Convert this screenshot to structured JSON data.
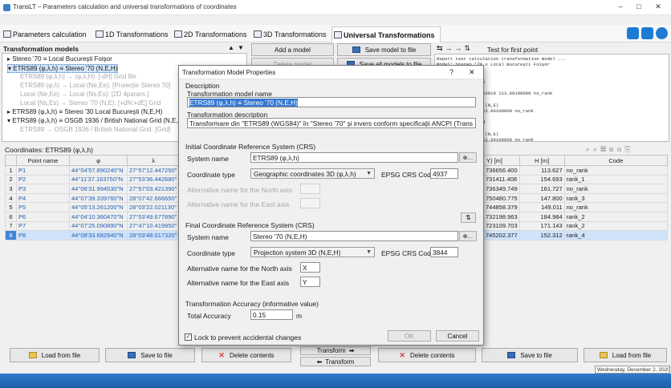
{
  "window": {
    "title": "TransLT – Parameters calculation and universal transformations of coordinates",
    "minimize": "–",
    "maximize": "□",
    "close": "✕"
  },
  "ribbon": {
    "tabs": [
      {
        "label": "Parameters calculation",
        "icon": "calc-icon"
      },
      {
        "label": "1D Transformations",
        "icon": "ruler-icon"
      },
      {
        "label": "2D Transformations",
        "icon": "grid-icon"
      },
      {
        "label": "3D Transformations",
        "icon": "cube-icon"
      },
      {
        "label": "Universal Transformations",
        "icon": "globe-icon",
        "active": true
      }
    ],
    "right_icons": [
      "gear-icon",
      "help-icon"
    ]
  },
  "models_panel": {
    "header": "Transformation models",
    "tree": [
      {
        "text": "Stereo '70 ≡ Local București Foișor",
        "state": "normal"
      },
      {
        "text": "ETRS89 (φ,λ,h) ≡ Stereo '70 (N,E,H)",
        "state": "selected"
      },
      {
        "text": "ETRS89 (φ,λ,h) → (φ,λ,H): [-dH] Grid file",
        "state": "dim"
      },
      {
        "text": "ETRS89 (φ,λ) → Local (Ne,Ee): [Proiecție Stereo 70]",
        "state": "dim"
      },
      {
        "text": "Local (Ne,Ee) → Local (Ns,Es): [2D 4param.]",
        "state": "dim"
      },
      {
        "text": "Local (Ns,Es) → Stereo '70 (N,E): [+dN;+dE] Grid",
        "state": "dim"
      },
      {
        "text": "ETRS89 (φ,λ,h) ≡ Stereo '30 Local București (N,E,H)",
        "state": "normal"
      },
      {
        "text": "ETRS89 (φ,λ,h) ≡ OSGB 1936 / British National Grid (N,E,H)",
        "state": "normal"
      },
      {
        "text": "ETRS89 → OSGB 1936 / British National Grid: [Grid]",
        "state": "dim"
      }
    ]
  },
  "actions": {
    "add_model": "Add a model",
    "delete_model": "Delete model",
    "save_model": "Save model to file",
    "save_all": "Save all models to file",
    "test_first_point": "Test for first point"
  },
  "report": {
    "lines": [
      "Report test calculation transformation model ...",
      "Model: Stereo '70 ≡ Local București Foișor",
      "",
      "",
      "Direction: Reverse",
      "",
      "291315.301665 92953019 113.89100000 no_rank",
      "",
      "→ Local București (N,E)",
      "291310.67701068 113.89100000 no_rank",
      "",
      "Direction: Forward",
      "",
      "→ Local București (N,E)",
      "291310.67701068 113.89100000 no_rank"
    ]
  },
  "coordinates": {
    "header": "Coordinates: ETRS89 (φ,λ,h)",
    "columns": [
      "Point name",
      "φ",
      "λ"
    ],
    "rows": [
      {
        "n": "1",
        "name": "P1",
        "phi": "44°04'57.890240\"N",
        "lam": "27°57'12.447250\""
      },
      {
        "n": "2",
        "name": "P2",
        "phi": "44°11'37.163750\"N",
        "lam": "27°53'36.442680\""
      },
      {
        "n": "3",
        "name": "P3",
        "phi": "44°06'31.994530\"N",
        "lam": "27°57'03.421390\""
      },
      {
        "n": "4",
        "name": "P4",
        "phi": "44°07'39.339760\"N",
        "lam": "28°07'42.666650\""
      },
      {
        "n": "5",
        "name": "P5",
        "phi": "44°05'13.261200\"N",
        "lam": "28°03'22.021130\""
      },
      {
        "n": "6",
        "name": "P6",
        "phi": "44°04'10.360470\"N",
        "lam": "27°53'49.677890\""
      },
      {
        "n": "7",
        "name": "P7",
        "phi": "44°07'25.090890\"N",
        "lam": "27°47'10.419950\""
      },
      {
        "n": "8",
        "name": "P8",
        "phi": "44°08'33.682940\"N",
        "lam": "28°03'48.017320\""
      }
    ]
  },
  "target_table": {
    "columns": [
      "Y) [m]",
      "H [m]",
      "Code"
    ],
    "rows": [
      {
        "y": "736656.400",
        "h": "113.627",
        "code": "no_rank"
      },
      {
        "y": "731411.408",
        "h": "154.693",
        "code": "rank_1"
      },
      {
        "y": "736349.749",
        "h": "161.727",
        "code": "no_rank"
      },
      {
        "y": "750480.775",
        "h": "147.800",
        "code": "rank_3"
      },
      {
        "y": "744858.379",
        "h": "149.011",
        "code": "no_rank"
      },
      {
        "y": "732198.963",
        "h": "184.984",
        "code": "rank_2"
      },
      {
        "y": "723109.703",
        "h": "171.143",
        "code": "rank_2"
      },
      {
        "y": "745202.377",
        "h": "152.312",
        "code": "rank_4"
      }
    ]
  },
  "bottom": {
    "load": "Load from file",
    "save": "Save to file",
    "delete": "Delete contents",
    "transform_fwd": "Transform",
    "transform_rev": "Transform",
    "load_right": "Load from file",
    "save_right": "Save to file",
    "delete_right": "Delete contents"
  },
  "dialog": {
    "title": "Transformation Model Properties",
    "help": "?",
    "close": "✕",
    "description_group": "Description",
    "name_label": "Transformation model name",
    "name_value": "ETRS89 (φ,λ,h) ≡ Stereo '70 (N,E,H)",
    "desc_label": "Transformation description",
    "desc_value": "Transformare din \"ETRS89 (WGS84)\" în \"Stereo '70\" și invers conform specificații ANCPI (Trans",
    "initial_group": "Initial Coordinate Reference System (CRS)",
    "system_name_label": "System name",
    "initial_system": "ETRS89 (φ,λ,h)",
    "coord_type_label": "Coordinate type",
    "initial_coord_type": "Geographic coordinates 3D (φ,λ,h)",
    "epsg_label": "EPSG CRS Code",
    "initial_epsg": "4937",
    "alt_north_label": "Alternative name for the North axis",
    "alt_east_label": "Alternative name for the East axis",
    "final_group": "Final Coordinate Reference System (CRS)",
    "final_system": "Stereo '70 (N,E,H)",
    "final_coord_type": "Projection system 3D (N,E,H)",
    "final_epsg": "3844",
    "final_north": "X",
    "final_east": "Y",
    "accuracy_group": "Transformation Accuracy (informative value)",
    "total_accuracy_label": "Total Accuracy",
    "total_accuracy": "0.15",
    "unit": "m",
    "lock_label": "Lock to prevent accidental changes",
    "ok": "OK",
    "cancel": "Cancel"
  },
  "taskbar": {
    "date_tooltip": "Wednesday, December 2, 2020"
  },
  "colors": {
    "accent": "#1e7bd4",
    "selection": "#3478d2"
  }
}
